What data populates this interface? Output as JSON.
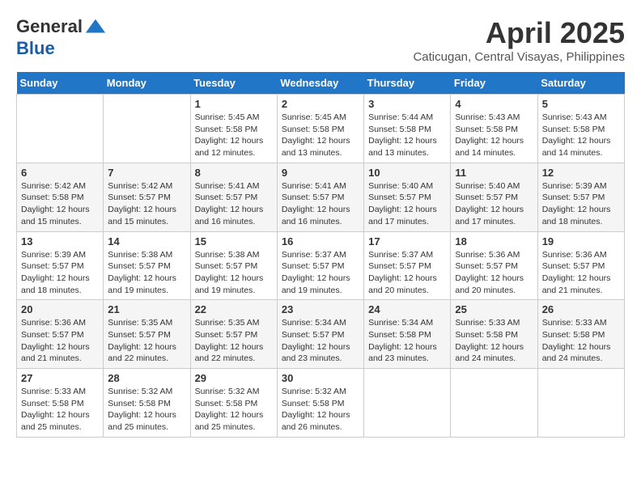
{
  "header": {
    "logo_line1": "General",
    "logo_line2": "Blue",
    "month": "April 2025",
    "location": "Caticugan, Central Visayas, Philippines"
  },
  "weekdays": [
    "Sunday",
    "Monday",
    "Tuesday",
    "Wednesday",
    "Thursday",
    "Friday",
    "Saturday"
  ],
  "weeks": [
    [
      {
        "day": "",
        "info": ""
      },
      {
        "day": "",
        "info": ""
      },
      {
        "day": "1",
        "info": "Sunrise: 5:45 AM\nSunset: 5:58 PM\nDaylight: 12 hours\nand 12 minutes."
      },
      {
        "day": "2",
        "info": "Sunrise: 5:45 AM\nSunset: 5:58 PM\nDaylight: 12 hours\nand 13 minutes."
      },
      {
        "day": "3",
        "info": "Sunrise: 5:44 AM\nSunset: 5:58 PM\nDaylight: 12 hours\nand 13 minutes."
      },
      {
        "day": "4",
        "info": "Sunrise: 5:43 AM\nSunset: 5:58 PM\nDaylight: 12 hours\nand 14 minutes."
      },
      {
        "day": "5",
        "info": "Sunrise: 5:43 AM\nSunset: 5:58 PM\nDaylight: 12 hours\nand 14 minutes."
      }
    ],
    [
      {
        "day": "6",
        "info": "Sunrise: 5:42 AM\nSunset: 5:58 PM\nDaylight: 12 hours\nand 15 minutes."
      },
      {
        "day": "7",
        "info": "Sunrise: 5:42 AM\nSunset: 5:57 PM\nDaylight: 12 hours\nand 15 minutes."
      },
      {
        "day": "8",
        "info": "Sunrise: 5:41 AM\nSunset: 5:57 PM\nDaylight: 12 hours\nand 16 minutes."
      },
      {
        "day": "9",
        "info": "Sunrise: 5:41 AM\nSunset: 5:57 PM\nDaylight: 12 hours\nand 16 minutes."
      },
      {
        "day": "10",
        "info": "Sunrise: 5:40 AM\nSunset: 5:57 PM\nDaylight: 12 hours\nand 17 minutes."
      },
      {
        "day": "11",
        "info": "Sunrise: 5:40 AM\nSunset: 5:57 PM\nDaylight: 12 hours\nand 17 minutes."
      },
      {
        "day": "12",
        "info": "Sunrise: 5:39 AM\nSunset: 5:57 PM\nDaylight: 12 hours\nand 18 minutes."
      }
    ],
    [
      {
        "day": "13",
        "info": "Sunrise: 5:39 AM\nSunset: 5:57 PM\nDaylight: 12 hours\nand 18 minutes."
      },
      {
        "day": "14",
        "info": "Sunrise: 5:38 AM\nSunset: 5:57 PM\nDaylight: 12 hours\nand 19 minutes."
      },
      {
        "day": "15",
        "info": "Sunrise: 5:38 AM\nSunset: 5:57 PM\nDaylight: 12 hours\nand 19 minutes."
      },
      {
        "day": "16",
        "info": "Sunrise: 5:37 AM\nSunset: 5:57 PM\nDaylight: 12 hours\nand 19 minutes."
      },
      {
        "day": "17",
        "info": "Sunrise: 5:37 AM\nSunset: 5:57 PM\nDaylight: 12 hours\nand 20 minutes."
      },
      {
        "day": "18",
        "info": "Sunrise: 5:36 AM\nSunset: 5:57 PM\nDaylight: 12 hours\nand 20 minutes."
      },
      {
        "day": "19",
        "info": "Sunrise: 5:36 AM\nSunset: 5:57 PM\nDaylight: 12 hours\nand 21 minutes."
      }
    ],
    [
      {
        "day": "20",
        "info": "Sunrise: 5:36 AM\nSunset: 5:57 PM\nDaylight: 12 hours\nand 21 minutes."
      },
      {
        "day": "21",
        "info": "Sunrise: 5:35 AM\nSunset: 5:57 PM\nDaylight: 12 hours\nand 22 minutes."
      },
      {
        "day": "22",
        "info": "Sunrise: 5:35 AM\nSunset: 5:57 PM\nDaylight: 12 hours\nand 22 minutes."
      },
      {
        "day": "23",
        "info": "Sunrise: 5:34 AM\nSunset: 5:57 PM\nDaylight: 12 hours\nand 23 minutes."
      },
      {
        "day": "24",
        "info": "Sunrise: 5:34 AM\nSunset: 5:58 PM\nDaylight: 12 hours\nand 23 minutes."
      },
      {
        "day": "25",
        "info": "Sunrise: 5:33 AM\nSunset: 5:58 PM\nDaylight: 12 hours\nand 24 minutes."
      },
      {
        "day": "26",
        "info": "Sunrise: 5:33 AM\nSunset: 5:58 PM\nDaylight: 12 hours\nand 24 minutes."
      }
    ],
    [
      {
        "day": "27",
        "info": "Sunrise: 5:33 AM\nSunset: 5:58 PM\nDaylight: 12 hours\nand 25 minutes."
      },
      {
        "day": "28",
        "info": "Sunrise: 5:32 AM\nSunset: 5:58 PM\nDaylight: 12 hours\nand 25 minutes."
      },
      {
        "day": "29",
        "info": "Sunrise: 5:32 AM\nSunset: 5:58 PM\nDaylight: 12 hours\nand 25 minutes."
      },
      {
        "day": "30",
        "info": "Sunrise: 5:32 AM\nSunset: 5:58 PM\nDaylight: 12 hours\nand 26 minutes."
      },
      {
        "day": "",
        "info": ""
      },
      {
        "day": "",
        "info": ""
      },
      {
        "day": "",
        "info": ""
      }
    ]
  ]
}
